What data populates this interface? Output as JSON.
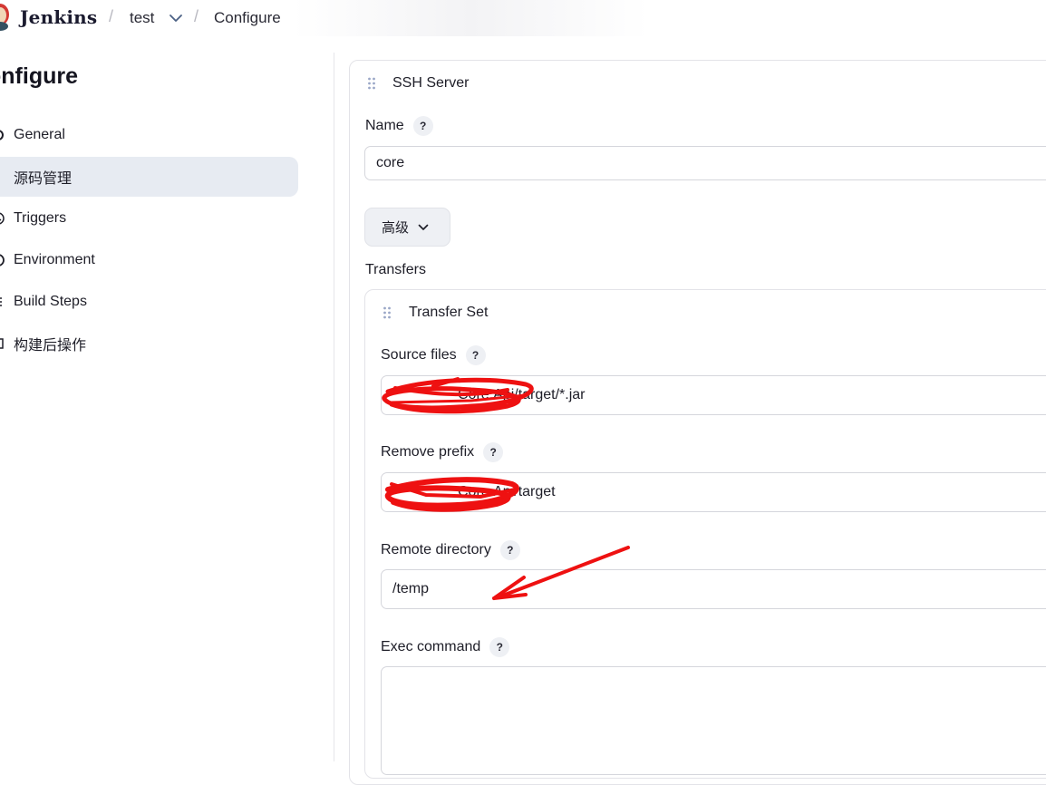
{
  "header": {
    "brand": "Jenkins",
    "breadcrumbs": [
      {
        "label": "test"
      },
      {
        "label": "Configure"
      }
    ],
    "separator": "/"
  },
  "sidebar": {
    "title": "onfigure",
    "items": [
      {
        "label": "General",
        "icon": "gear-icon"
      },
      {
        "label": "源码管理",
        "icon": "code-branch-icon",
        "active": true
      },
      {
        "label": "Triggers",
        "icon": "clock-icon"
      },
      {
        "label": "Environment",
        "icon": "globe-icon"
      },
      {
        "label": "Build Steps",
        "icon": "list-icon"
      },
      {
        "label": "构建后操作",
        "icon": "box-icon"
      }
    ]
  },
  "ssh_server": {
    "title": "SSH Server",
    "name_label": "Name",
    "name_value": "core",
    "advanced_label": "高级",
    "transfers_label": "Transfers"
  },
  "transfer_set": {
    "title": "Transfer Set",
    "source_files_label": "Source files",
    "source_files_value": "Core.Api/target/*.jar",
    "remove_prefix_label": "Remove prefix",
    "remove_prefix_value": "Core.Api/target",
    "remote_directory_label": "Remote directory",
    "remote_directory_value": "/temp",
    "exec_command_label": "Exec command",
    "exec_command_value": ""
  },
  "help_glyph": "?",
  "colors": {
    "annotation_red": "#ee1111",
    "active_sidebar_bg": "#e7ebf2",
    "help_bg": "#eef0f4"
  }
}
